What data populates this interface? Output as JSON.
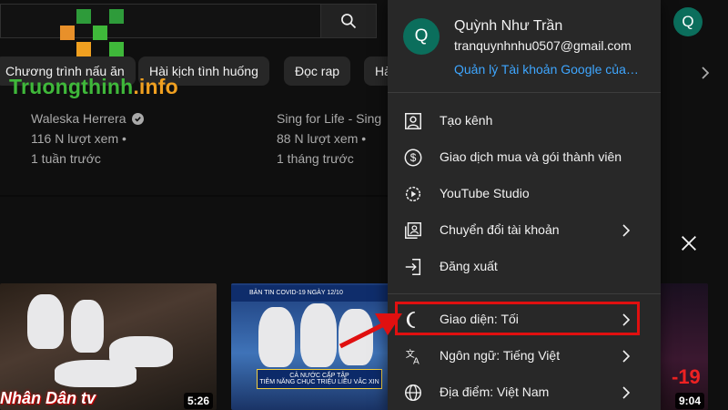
{
  "chips": [
    "Chương trình nấu ăn",
    "Hài kịch tình huống",
    "Đọc rap",
    "Hà"
  ],
  "logo": {
    "part1": "Truongthinh",
    "part2": ".info"
  },
  "videos": [
    {
      "channel": "Waleska Herrera",
      "views": "116 N lượt xem",
      "age": "1 tuần trước"
    },
    {
      "channel": "Sing for Life - Sing",
      "views": "88 N lượt xem",
      "age": "1 tháng trước"
    }
  ],
  "thumbnails": [
    {
      "duration": "5:26",
      "brand": "Nhân Dân tv"
    },
    {
      "strip": "BẢN TIN COVID-19 NGÀY 12/10",
      "caption_line1": "CẢ NƯỚC CẤP TẬP",
      "caption_line2": "TIÊM NĂNG CHỤC TRIỆU LIỀU VẮC XIN"
    },
    {
      "duration": "9:04",
      "number": "-19"
    }
  ],
  "top_avatar_letter": "Q",
  "account": {
    "avatar_letter": "Q",
    "name": "Quỳnh Như Trần",
    "email": "tranquynhnhu0507@gmail.com",
    "manage_link": "Quản lý Tài khoản Google của bạn"
  },
  "menu_items": [
    {
      "label": "Tạo kênh",
      "icon": "person-icon",
      "chevron": false
    },
    {
      "label": "Giao dịch mua và gói thành viên",
      "icon": "dollar-icon",
      "chevron": false
    },
    {
      "label": "YouTube Studio",
      "icon": "gear-play-icon",
      "chevron": false
    },
    {
      "label": "Chuyển đổi tài khoản",
      "icon": "switch-account-icon",
      "chevron": true
    },
    {
      "label": "Đăng xuất",
      "icon": "sign-out-icon",
      "chevron": false
    },
    {
      "label": "Giao diện: Tối",
      "icon": "moon-icon",
      "chevron": true
    },
    {
      "label": "Ngôn ngữ: Tiếng Việt",
      "icon": "translate-icon",
      "chevron": true
    },
    {
      "label": "Địa điểm: Việt Nam",
      "icon": "globe-icon",
      "chevron": true
    }
  ],
  "colors": {
    "accent_link": "#3ea6ff",
    "avatar": "#0b6e5c",
    "highlight": "#e01010",
    "menu_bg": "#282828",
    "page_bg": "#0f0f0f"
  }
}
